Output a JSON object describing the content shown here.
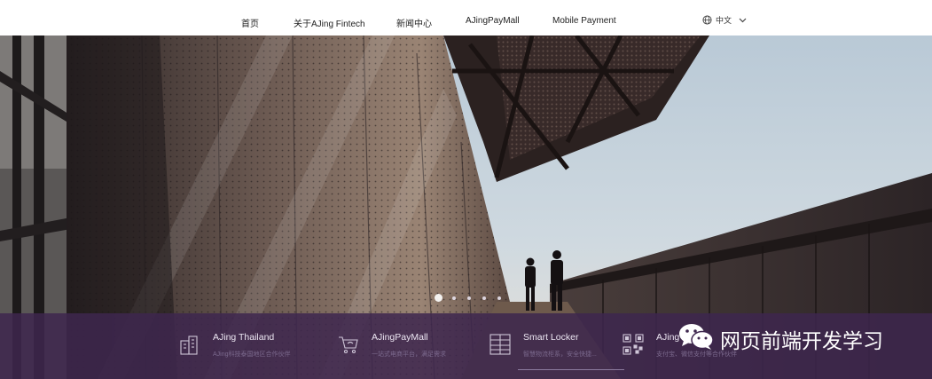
{
  "nav": {
    "items": [
      {
        "label": "首页"
      },
      {
        "label": "关于AJing Fintech"
      },
      {
        "label": "新闻中心"
      },
      {
        "label": "AJingPayMall"
      },
      {
        "label": "Mobile Payment"
      }
    ],
    "language": {
      "label": "中文",
      "icon": "globe-icon",
      "caret": "chevron-down-icon"
    }
  },
  "hero": {
    "slide_count": 5,
    "active_slide": 1
  },
  "features": [
    {
      "title": "AJing Thailand",
      "subtitle": "AJing科技泰国地区合作伙伴",
      "icon": "building-icon"
    },
    {
      "title": "AJingPayMall",
      "subtitle": "一站式电商平台，满足需求",
      "icon": "shopping-cart-icon"
    },
    {
      "title": "Smart Locker",
      "subtitle": "智慧物流柜系，安全快捷...",
      "icon": "locker-icon"
    },
    {
      "title": "AJing P",
      "subtitle": "支付宝、微信支付等合作伙伴",
      "icon": "qr-code-icon"
    }
  ],
  "watermark": {
    "text": "网页前端开发学习",
    "icon": "wechat-icon"
  },
  "colors": {
    "band": "#3e264e",
    "sky": "#c9d6df",
    "nav_text": "#222222"
  }
}
